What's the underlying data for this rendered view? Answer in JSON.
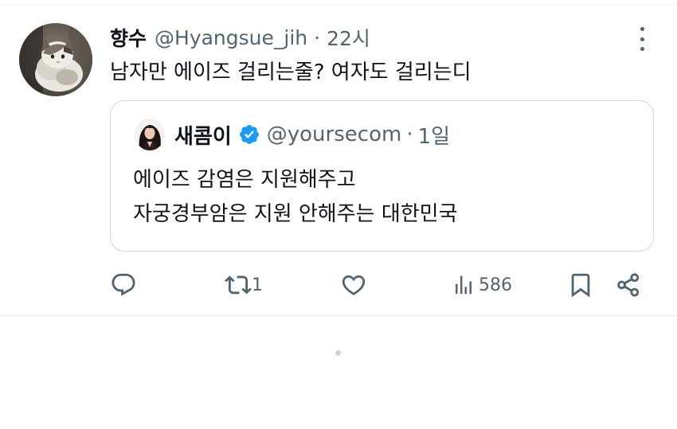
{
  "tweet": {
    "author_name": "향수",
    "author_handle": "@Hyangsue_jih",
    "separator": "·",
    "time": "22시",
    "text": "남자만 에이즈 걸리는줄? 여자도 걸리는디",
    "avatar_icon": "cat-photo-avatar",
    "more_icon": "more-options-icon"
  },
  "quote": {
    "author_name": "새콤이",
    "verified": true,
    "verified_color": "#1d9bf0",
    "author_handle": "@yoursecom",
    "separator": "·",
    "time": "1일",
    "lines": [
      "에이즈 감염은 지원해주고",
      "자궁경부암은 지원 안해주는 대한민국"
    ]
  },
  "actions": {
    "reply_count": "",
    "retweet_count": "1",
    "like_count": "",
    "views_count": "586",
    "icons": [
      "reply-icon",
      "retweet-icon",
      "like-icon",
      "views-icon",
      "bookmark-icon",
      "share-icon"
    ]
  },
  "colors": {
    "text_primary": "#0f1419",
    "text_secondary": "#536471",
    "border": "#cfd9de"
  }
}
